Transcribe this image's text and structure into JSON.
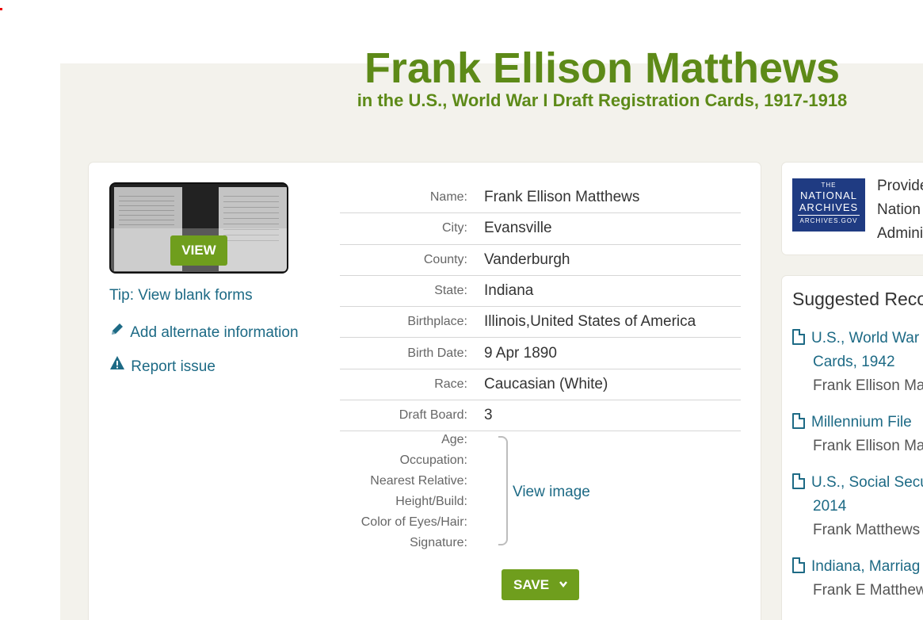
{
  "record": {
    "name": "Frank Ellison Matthews",
    "collection": "in the U.S., World War I Draft Registration Cards, 1917-1918"
  },
  "image_panel": {
    "view_label": "VIEW",
    "tip_label": "Tip: View blank forms",
    "add_alt_label": "Add alternate information",
    "report_label": "Report issue"
  },
  "fields": [
    {
      "label": "Name:",
      "value": "Frank Ellison Matthews"
    },
    {
      "label": "City:",
      "value": "Evansville"
    },
    {
      "label": "County:",
      "value": "Vanderburgh"
    },
    {
      "label": "State:",
      "value": "Indiana"
    },
    {
      "label": "Birthplace:",
      "value": "Illinois,United States of America"
    },
    {
      "label": "Birth Date:",
      "value": "9 Apr 1890"
    },
    {
      "label": "Race:",
      "value": "Caucasian (White)"
    },
    {
      "label": "Draft Board:",
      "value": "3"
    }
  ],
  "image_fields": {
    "labels": [
      "Age:",
      "Occupation:",
      "Nearest Relative:",
      "Height/Build:",
      "Color of Eyes/Hair:",
      "Signature:"
    ],
    "view_image_label": "View image"
  },
  "save_label": "SAVE",
  "provider": {
    "logo_lines": [
      "THE",
      "NATIONAL",
      "ARCHIVES",
      "ARCHIVES.GOV"
    ],
    "text_lines": [
      "Provide",
      "Nation",
      "Admini"
    ]
  },
  "suggested": {
    "title": "Suggested Reco",
    "items": [
      {
        "title": "U.S., World War",
        "cont": "Cards, 1942",
        "who": "Frank Ellison Ma"
      },
      {
        "title": "Millennium File",
        "cont": "",
        "who": "Frank Ellison Ma"
      },
      {
        "title": "U.S., Social Secu",
        "cont": "2014",
        "who": "Frank Matthews"
      },
      {
        "title": "Indiana, Marriag",
        "cont": "",
        "who": "Frank E Matthew"
      }
    ]
  },
  "colors": {
    "accent_green": "#6f9e1d",
    "title_green": "#5d8a18",
    "link_blue": "#1d6a85",
    "archives_blue": "#1f3b82"
  },
  "icons": [
    "pencil-icon",
    "warning-icon",
    "chevron-down-icon",
    "document-icon"
  ]
}
